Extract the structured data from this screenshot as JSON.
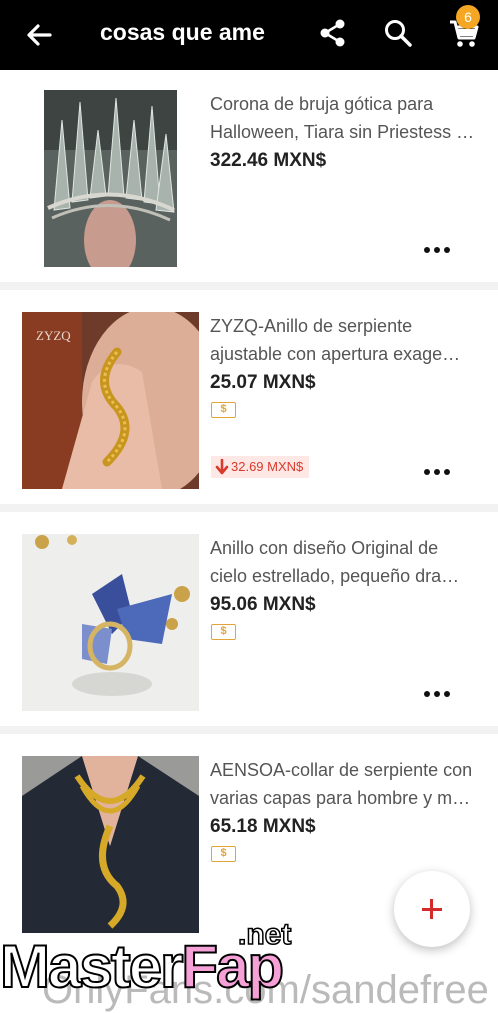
{
  "header": {
    "title": "cosas que ame",
    "cart_count": "6",
    "icons": [
      "back-arrow-icon",
      "share-icon",
      "search-icon",
      "cart-icon"
    ]
  },
  "items": [
    {
      "name_line1": "Corona de bruja gótica para",
      "name_line2": "Halloween, Tiara sin Priestess …",
      "price": "322.46 MXN$",
      "has_tag": false
    },
    {
      "name_line1": "ZYZQ-Anillo de serpiente",
      "name_line2": "ajustable con apertura exage…",
      "price": "25.07 MXN$",
      "has_tag": true,
      "tag_symbol": "$",
      "price_drop": "32.69 MXN$",
      "image_text": "ZYZQ"
    },
    {
      "name_line1": "Anillo con diseño Original de",
      "name_line2": "cielo estrellado, pequeño dra…",
      "price": "95.06 MXN$",
      "has_tag": true,
      "tag_symbol": "$"
    },
    {
      "name_line1": "AENSOA-collar de serpiente con",
      "name_line2": "varias capas para hombre y m…",
      "price": "65.18 MXN$",
      "has_tag": true,
      "tag_symbol": "$"
    }
  ],
  "watermark": {
    "main_a": "Master",
    "main_b": "Fap",
    "suffix": ".net",
    "sub": "OnlyFans.com/sandefree"
  },
  "colors": {
    "appbar": "#000000",
    "badge": "#f5a623",
    "price_drop": "#d93a2b",
    "tag": "#e2a33a",
    "fab_plus": "#d32a2a"
  }
}
